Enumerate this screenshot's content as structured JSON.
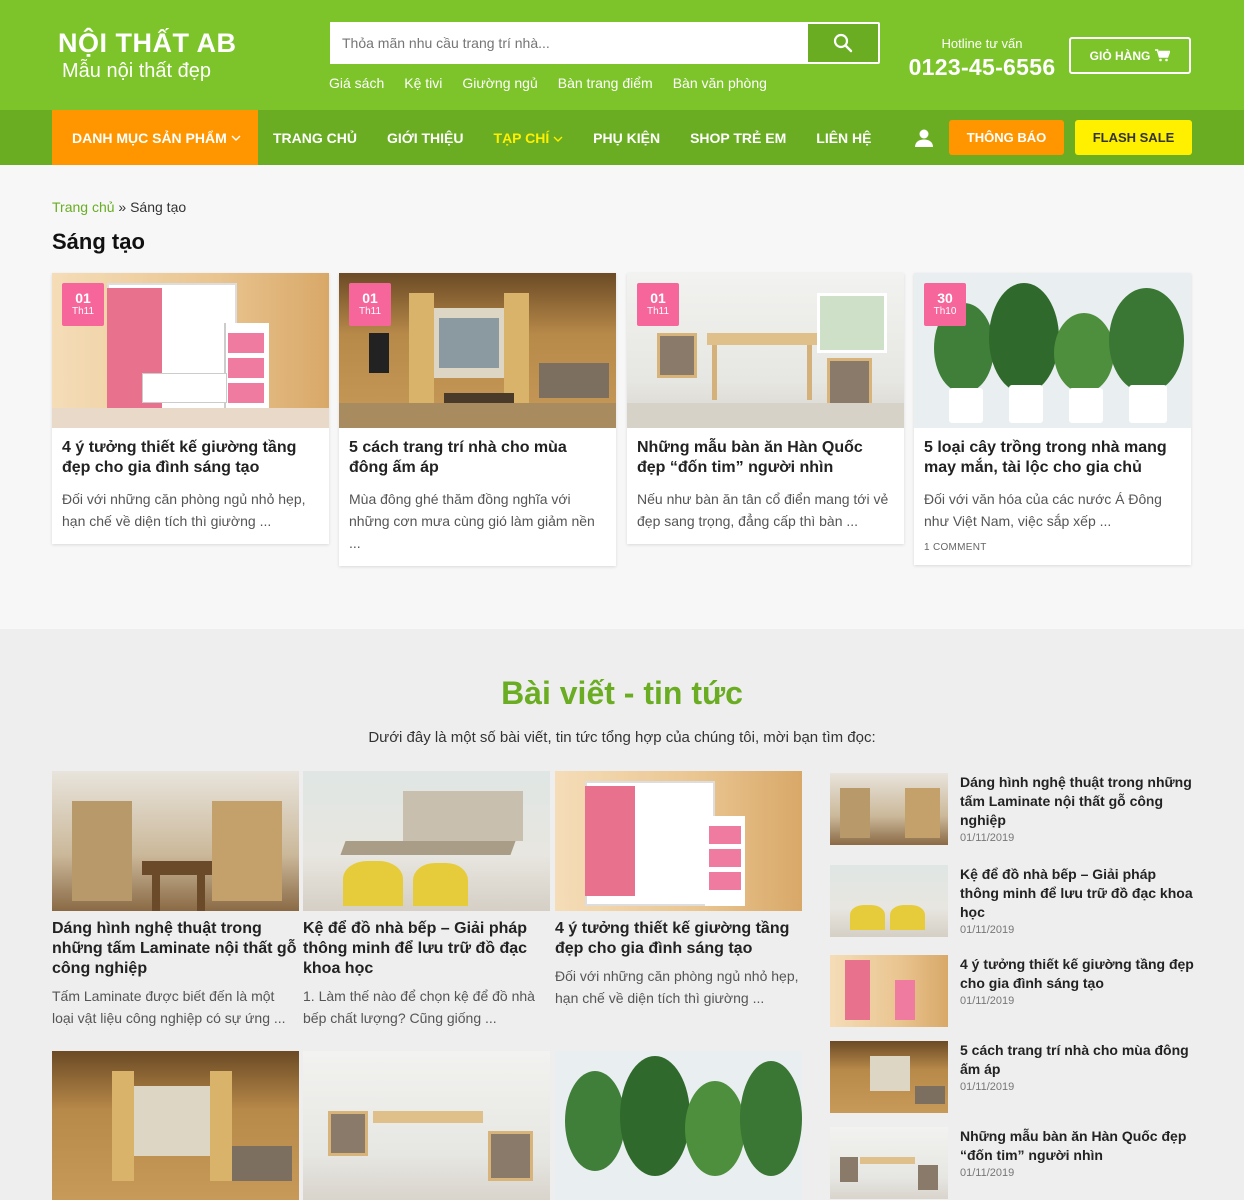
{
  "header": {
    "logo_title": "NỘI THẤT AB",
    "logo_tagline": "Mẫu nội thất đẹp",
    "search_placeholder": "Thỏa mãn nhu cầu trang trí nhà...",
    "quick_links": [
      "Giá sách",
      "Kệ tivi",
      "Giường ngủ",
      "Bàn trang điểm",
      "Bàn văn phòng"
    ],
    "hotline_label": "Hotline tư vấn",
    "hotline_number": "0123-45-6556",
    "cart_label": "GIỎ HÀNG"
  },
  "nav": {
    "category_label": "DANH MỤC SẢN PHẨM",
    "items": [
      "TRANG CHỦ",
      "GIỚI THIỆU",
      "TẠP CHÍ",
      "PHỤ KIỆN",
      "SHOP TRẺ EM",
      "LIÊN HỆ"
    ],
    "notify_label": "THÔNG BÁO",
    "flash_label": "FLASH SALE"
  },
  "breadcrumb": {
    "home": "Trang chủ",
    "separator": "»",
    "current": "Sáng tạo"
  },
  "page_title": "Sáng tạo",
  "posts": [
    {
      "day": "01",
      "month": "Th11",
      "title": "4 ý tưởng thiết kế giường tầng đẹp cho gia đình sáng tạo",
      "excerpt": "Đối với những căn phòng ngủ nhỏ hẹp, hạn chế về diện tích thì giường ...",
      "comments": ""
    },
    {
      "day": "01",
      "month": "Th11",
      "title": "5 cách trang trí nhà cho mùa đông ấm áp",
      "excerpt": "Mùa đông ghé thăm đồng nghĩa với những cơn mưa cùng gió làm giảm nền ...",
      "comments": ""
    },
    {
      "day": "01",
      "month": "Th11",
      "title": "Những mẫu bàn ăn Hàn Quốc đẹp “đốn tim” người nhìn",
      "excerpt": "Nếu như bàn ăn tân cổ điển mang tới vẻ đẹp sang trọng, đẳng cấp thì bàn ...",
      "comments": ""
    },
    {
      "day": "30",
      "month": "Th10",
      "title": "5 loại cây trồng trong nhà mang may mắn, tài lộc cho gia chủ",
      "excerpt": "Đối với văn hóa của các nước Á Đông như Việt Nam, việc sắp xếp ...",
      "comments": "1 COMMENT"
    }
  ],
  "news": {
    "heading": "Bài viết - tin tức",
    "subheading": "Dưới đây là một số bài viết, tin tức tổng hợp của chúng tôi, mời bạn tìm đọc:",
    "cards": [
      {
        "title": "Dáng hình nghệ thuật trong những tấm Laminate nội thất gỗ công nghiệp",
        "excerpt": "Tấm Laminate được biết đến là một loại vật liệu công nghiệp có sự ứng ..."
      },
      {
        "title": "Kệ để đồ nhà bếp – Giải pháp thông minh để lưu trữ đồ đạc khoa học",
        "excerpt": "1. Làm thế nào để chọn kệ để đồ nhà bếp chất lượng? Cũng giống ..."
      },
      {
        "title": "4 ý tưởng thiết kế giường tầng đẹp cho gia đình sáng tạo",
        "excerpt": "Đối với những căn phòng ngủ nhỏ hẹp, hạn chế về diện tích thì giường ..."
      }
    ],
    "sidebar": [
      {
        "title": "Dáng hình nghệ thuật trong những tấm Laminate nội thất gỗ công nghiệp",
        "date": "01/11/2019"
      },
      {
        "title": "Kệ để đồ nhà bếp – Giải pháp thông minh để lưu trữ đồ đạc khoa học",
        "date": "01/11/2019"
      },
      {
        "title": "4 ý tưởng thiết kế giường tầng đẹp cho gia đình sáng tạo",
        "date": "01/11/2019"
      },
      {
        "title": "5 cách trang trí nhà cho mùa đông ấm áp",
        "date": "01/11/2019"
      },
      {
        "title": "Những mẫu bàn ăn Hàn Quốc đẹp “đốn tim” người nhìn",
        "date": "01/11/2019"
      }
    ]
  },
  "colors": {
    "brand_green": "#7cc42a",
    "nav_green": "#6aad23",
    "orange": "#ff9600",
    "yellow": "#fff000",
    "date_pink": "#f7669b"
  },
  "icons": {
    "search": "search-icon",
    "cart": "cart-icon",
    "user": "user-icon",
    "chevron": "chevron-down-icon"
  }
}
